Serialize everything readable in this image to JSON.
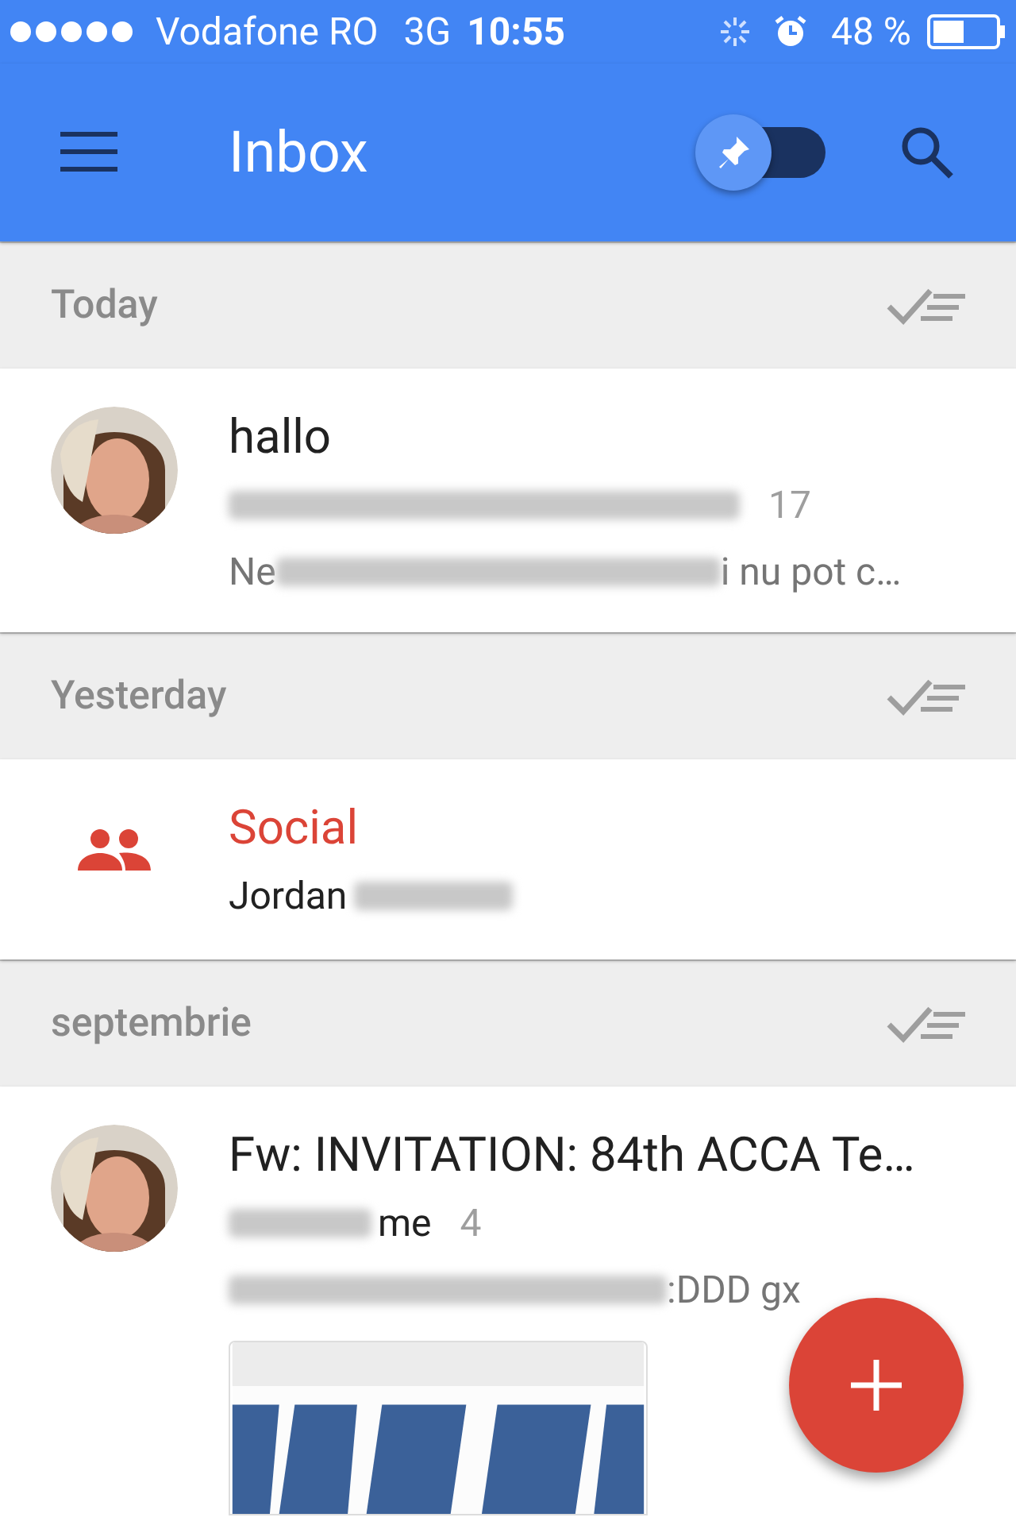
{
  "status_bar": {
    "carrier": "Vodafone RO",
    "network": "3G",
    "time": "10:55",
    "battery": "48 %"
  },
  "toolbar": {
    "title": "Inbox",
    "pinned_toggle": {
      "on": false
    }
  },
  "sections": [
    {
      "title": "Today",
      "items": [
        {
          "kind": "thread",
          "subject": "hallo",
          "senders": [
            {
              "kind": "redacted"
            }
          ],
          "count": "17",
          "snippet": [
            {
              "kind": "text",
              "text": "Ne"
            },
            {
              "kind": "redacted"
            },
            {
              "kind": "text",
              "text": "i nu pot c…"
            }
          ]
        }
      ]
    },
    {
      "title": "Yesterday",
      "items": [
        {
          "kind": "bundle",
          "subject": "Social",
          "senders": [
            {
              "kind": "text",
              "text": "Jordan"
            },
            {
              "kind": "redacted"
            }
          ]
        }
      ]
    },
    {
      "title": "septembrie",
      "items": [
        {
          "kind": "thread",
          "subject": "Fw: INVITATION: 84th ACCA Te…",
          "senders": [
            {
              "kind": "redacted"
            },
            {
              "kind": "text",
              "text": "me"
            }
          ],
          "count": "4",
          "snippet": [
            {
              "kind": "redacted"
            },
            {
              "kind": "text",
              "text": ":DDD gx"
            }
          ],
          "attachment": {
            "kind": "picture"
          }
        }
      ]
    }
  ]
}
